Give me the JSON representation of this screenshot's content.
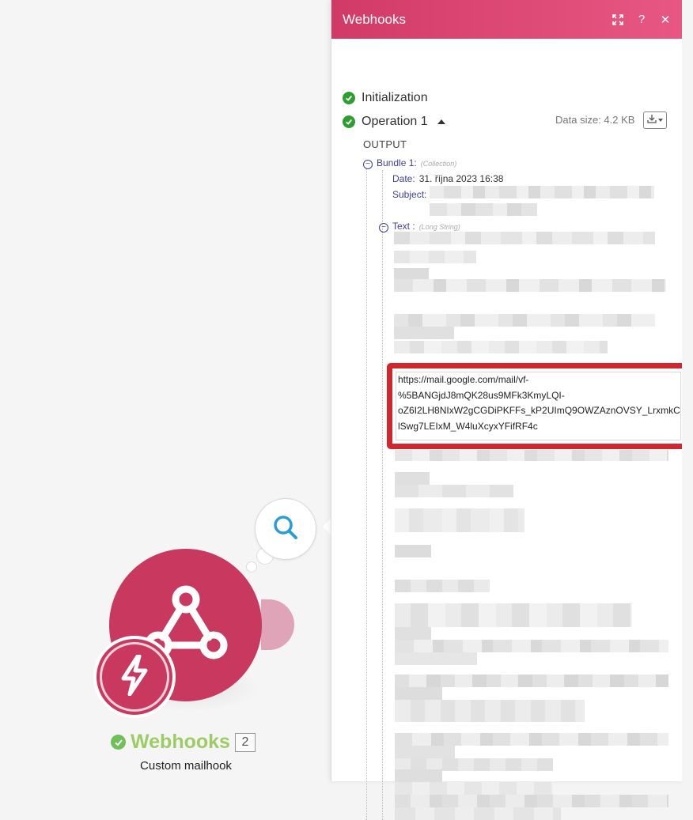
{
  "panel": {
    "title": "Webhooks",
    "header_icons": [
      "expand-icon",
      "help-icon",
      "close-icon"
    ],
    "header_gradient": [
      "#d23a66",
      "#e85784"
    ]
  },
  "log": {
    "initialization": "Initialization",
    "operation": "Operation 1",
    "data_size": "Data size: 4.2 KB",
    "output_label": "OUTPUT"
  },
  "bundle": {
    "label": "Bundle 1:",
    "type": "(Collection)",
    "date_key": "Date:",
    "date_value": "31. října 2023 16:38",
    "subject_key": "Subject:",
    "text_key": "Text :",
    "text_type": "(Long String)"
  },
  "url_lines": [
    "https://mail.google.com/mail/vf-",
    "%5BANGjdJ8mQK28us9MFk3KmyLQI-",
    "oZ6I2LH8NIxW2gCGDiPKFFs_kP2UImQ9OWZAznOVSY_LrxmkC",
    "lSwg7LEIxM_W4luXcyxYFifRF4c"
  ],
  "module": {
    "name": "Webhooks",
    "count": "2",
    "subtitle": "Custom mailhook",
    "color": "#c9385f",
    "name_color": "#9ccc65"
  },
  "highlight_color": "#d0262e"
}
